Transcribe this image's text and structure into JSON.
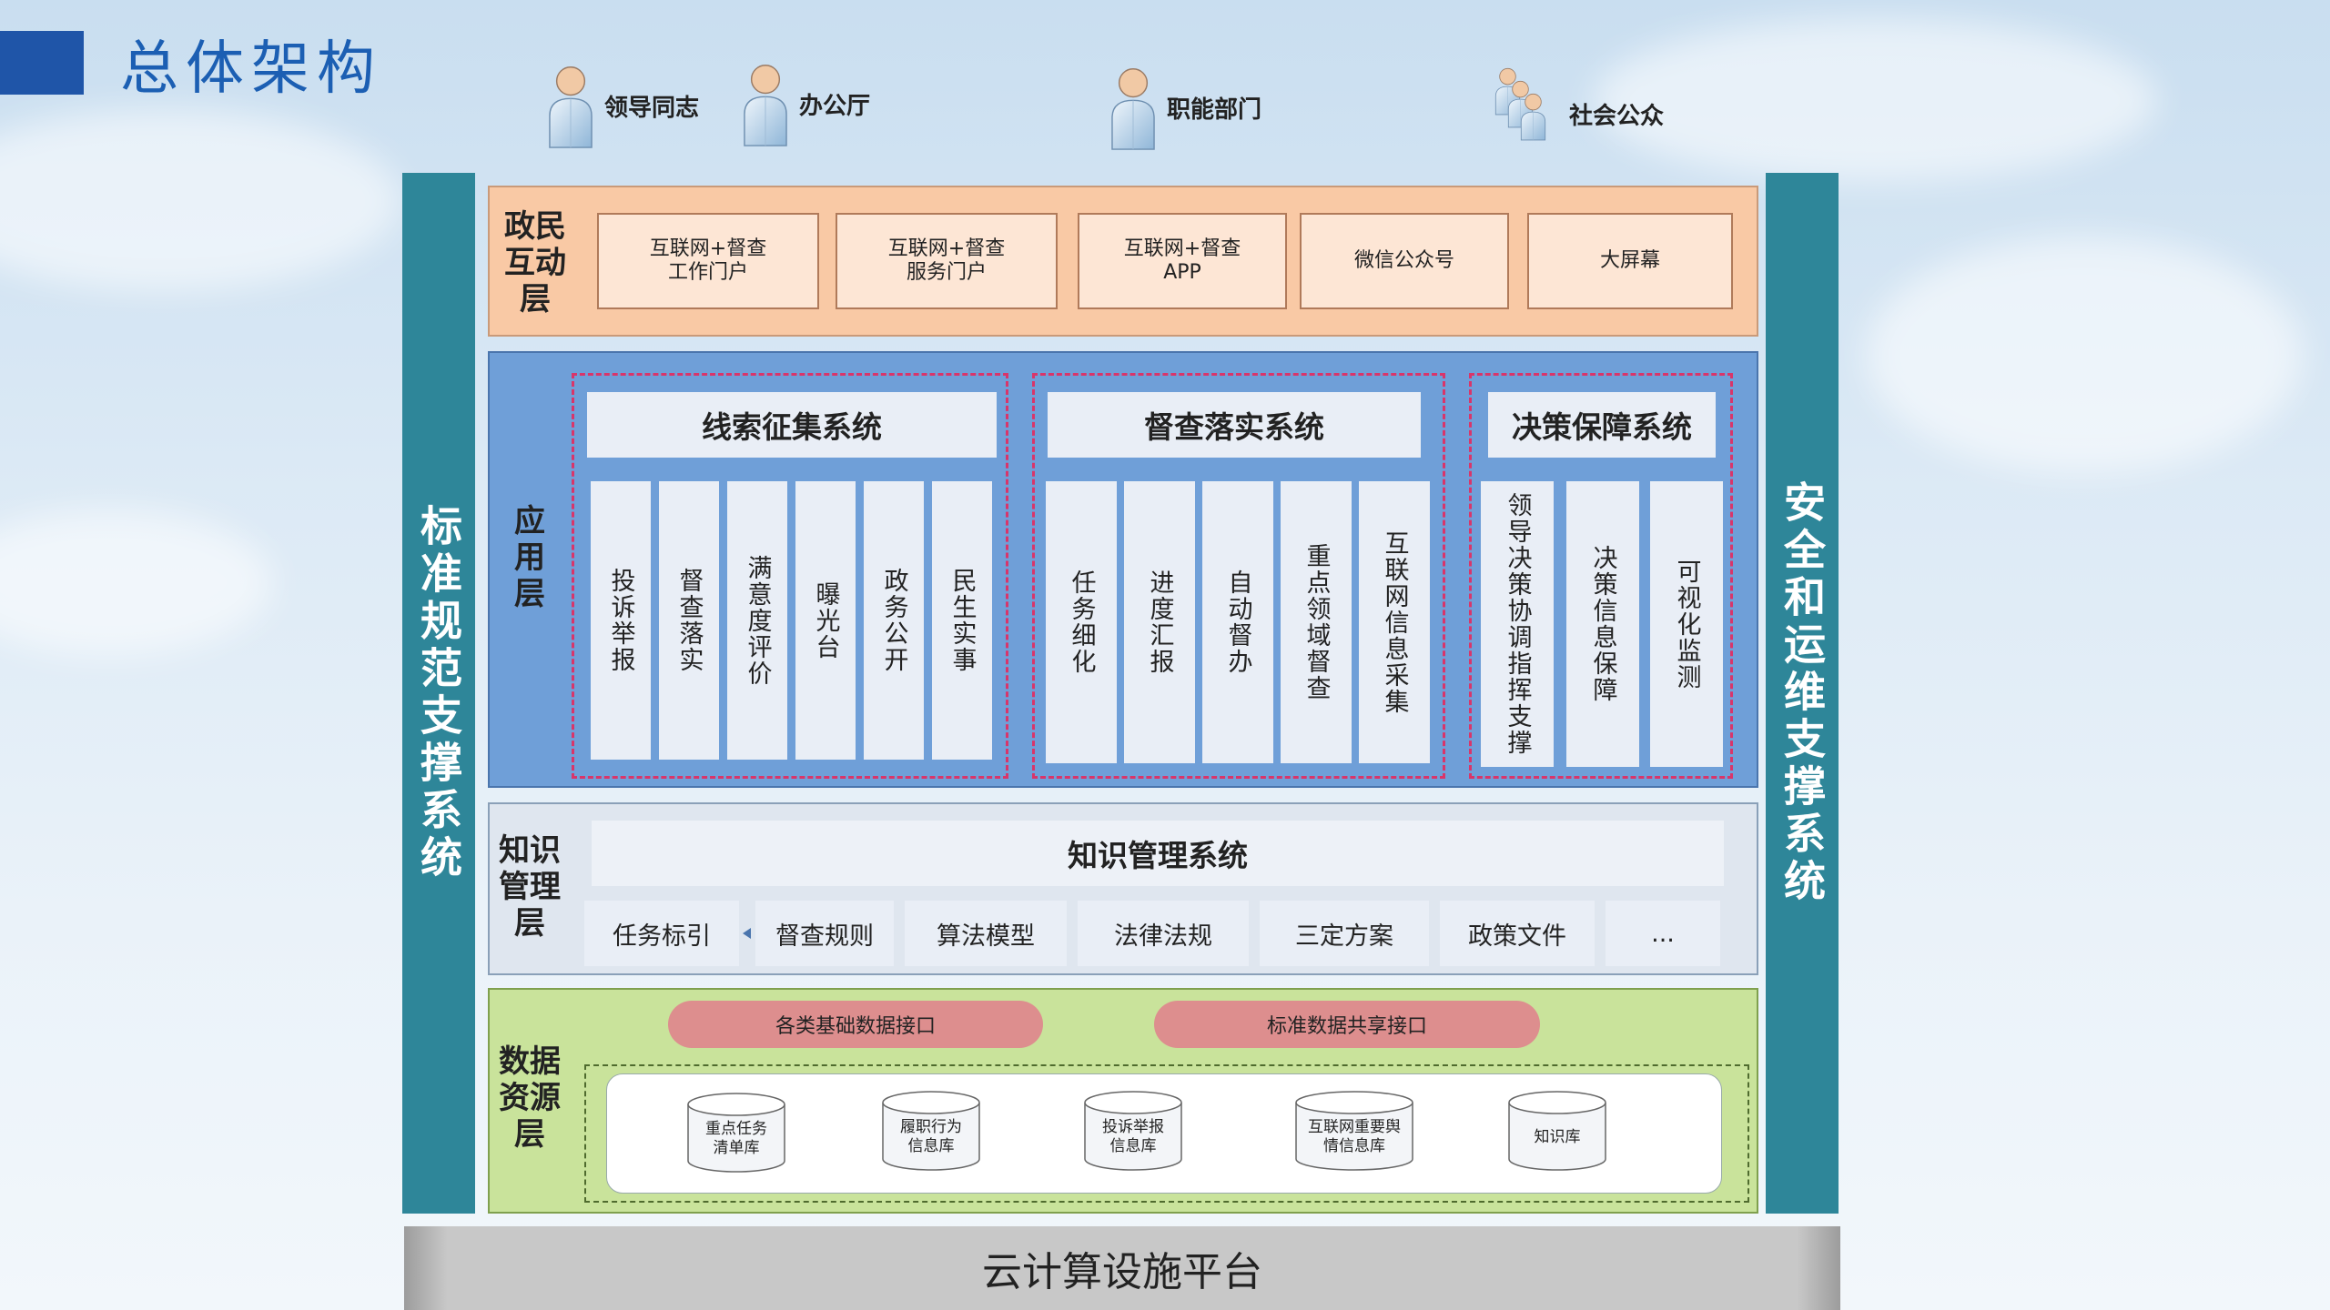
{
  "title": "总体架构",
  "users": [
    {
      "label": "领导同志",
      "icon": "person-icon"
    },
    {
      "label": "办公厅",
      "icon": "person-icon"
    },
    {
      "label": "职能部门",
      "icon": "person-icon"
    },
    {
      "label": "社会公众",
      "icon": "group-icon"
    }
  ],
  "side_left": "标准规范支撑系统",
  "side_right": "安全和运维支撑系统",
  "interaction_layer": {
    "label": "政民\n互动\n层",
    "portals": [
      "互联网+督查\n工作门户",
      "互联网+督查\n服务门户",
      "互联网+督查\nAPP",
      "微信公众号",
      "大屏幕"
    ]
  },
  "application_layer": {
    "label": "应\n用\n层",
    "systems": [
      {
        "title": "线索征集系统",
        "items": [
          "投诉举报",
          "督查落实",
          "满意度评价",
          "曝光台",
          "政务公开",
          "民生实事"
        ]
      },
      {
        "title": "督查落实系统",
        "items": [
          "任务细化",
          "进度汇报",
          "自动督办",
          "重点领域督查",
          "互联网信息采集"
        ]
      },
      {
        "title": "决策保障系统",
        "items": [
          "领导决策协调指挥支撑",
          "决策信息保障",
          "可视化监测"
        ]
      }
    ]
  },
  "knowledge_layer": {
    "label": "知识\n管理\n层",
    "system": "知识管理系统",
    "items": [
      "任务标引",
      "督查规则",
      "算法模型",
      "法律法规",
      "三定方案",
      "政策文件",
      "..."
    ]
  },
  "data_layer": {
    "label": "数据\n资源\n层",
    "interfaces": [
      "各类基础数据接口",
      "标准数据共享接口"
    ],
    "databases": [
      "重点任务\n清单库",
      "履职行为\n信息库",
      "投诉举报\n信息库",
      "互联网重要舆\n情信息库",
      "知识库"
    ]
  },
  "platform": "云计算设施平台",
  "colors": {
    "title_bar": "#1f55a8",
    "side_columns": "#2e8699",
    "interaction_layer": "#f9c9a5",
    "application_layer": "#6f9fd8",
    "knowledge_layer": "#dfe6ef",
    "data_layer": "#c9e39b",
    "dashed_border": "#d9356a",
    "interface_pill": "#dd8e8e"
  }
}
